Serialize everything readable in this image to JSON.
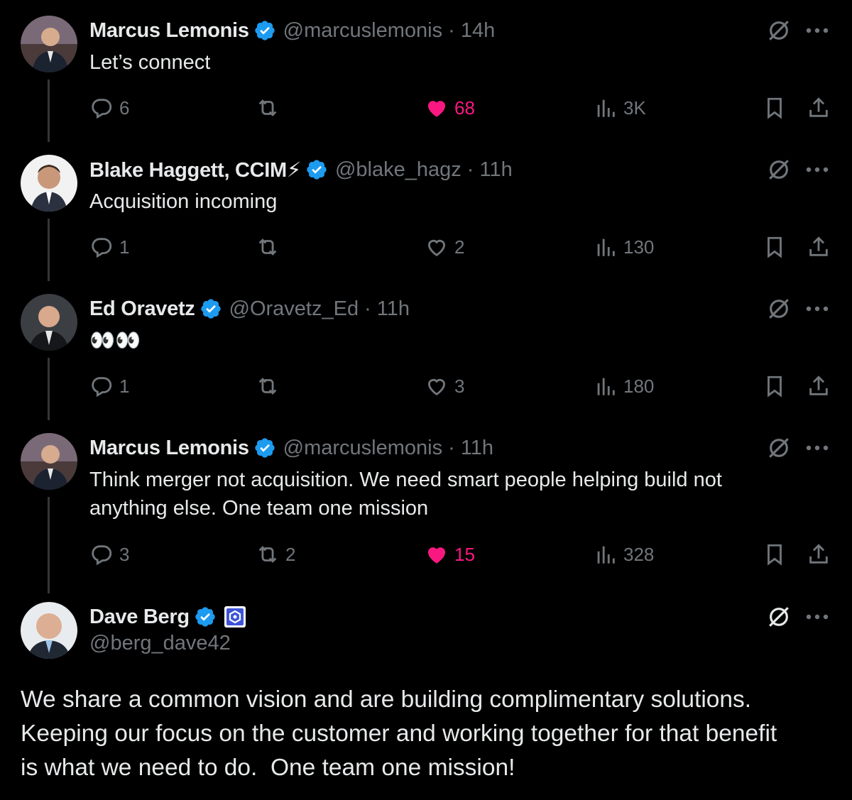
{
  "colors": {
    "background": "#000000",
    "text": "#e7e9ea",
    "muted": "#71767b",
    "verified": "#1d9bf0",
    "like": "#f91880",
    "affiliate": "#3d54d8"
  },
  "tweets": [
    {
      "name": "Marcus Lemonis",
      "handle": "@marcuslemonis",
      "time": "· 14h",
      "text": "Let’s connect",
      "replies": "6",
      "retweets": "",
      "likes": "68",
      "views": "3K",
      "liked": true
    },
    {
      "name": "Blake Haggett, CCIM⚡",
      "handle": "@blake_hagz",
      "time": "· 11h",
      "text": "Acquisition incoming",
      "replies": "1",
      "retweets": "",
      "likes": "2",
      "views": "130",
      "liked": false
    },
    {
      "name": "Ed Oravetz",
      "handle": "@Oravetz_Ed",
      "time": "· 11h",
      "text": "👀👀",
      "replies": "1",
      "retweets": "",
      "likes": "3",
      "views": "180",
      "liked": false
    },
    {
      "name": "Marcus Lemonis",
      "handle": "@marcuslemonis",
      "time": "· 11h",
      "text_line1": "Think merger not acquisition. We need smart people helping build not",
      "text_line2": "anything else. One team one mission",
      "replies": "3",
      "retweets": "2",
      "likes": "15",
      "views": "328",
      "liked": true
    }
  ],
  "main_tweet": {
    "name": "Dave Berg",
    "handle": "@berg_dave42",
    "line1": "We share a common vision and are building complimentary solutions.",
    "line2": "Keeping our focus on the customer and working together for that benefit",
    "line3": "is what we need to do.  One team one mission!"
  }
}
